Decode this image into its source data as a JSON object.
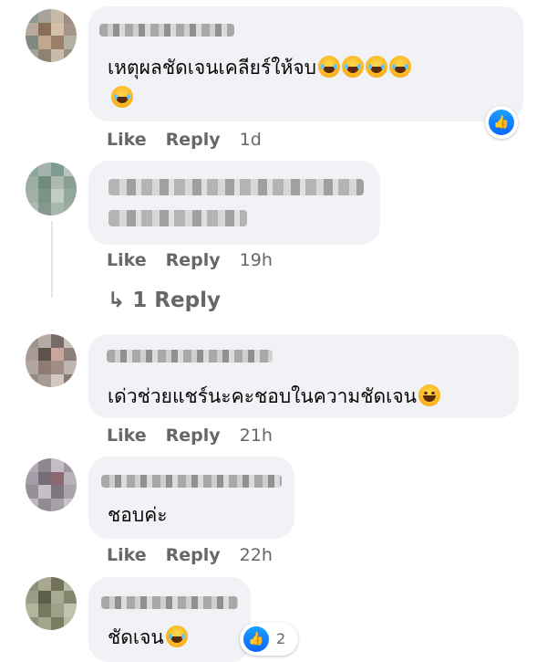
{
  "comments": [
    {
      "text": "เหตุผลชัดเจนเคลียร์ให้จบ",
      "like": "Like",
      "reply": "Reply",
      "time": "1d"
    },
    {
      "text": "",
      "like": "Like",
      "reply": "Reply",
      "time": "19h",
      "replies_link": "1 Reply"
    },
    {
      "text": "เด่วช่วยแชร์นะคะชอบในความชัดเจน",
      "like": "Like",
      "reply": "Reply",
      "time": "21h"
    },
    {
      "text": "ชอบค่ะ",
      "like": "Like",
      "reply": "Reply",
      "time": "22h"
    },
    {
      "text": "ชัดเจน",
      "reaction_count": "2"
    }
  ],
  "icons": {
    "like_reaction": "thumbs-up-icon",
    "reply_arrow": "reply-arrow-icon",
    "emoji": "laughing-tears-emoji",
    "grin": "grinning-emoji"
  },
  "colors": {
    "bubble": "#f0f2f5",
    "action_text": "#65676b",
    "like_blue": "#0866ff"
  }
}
